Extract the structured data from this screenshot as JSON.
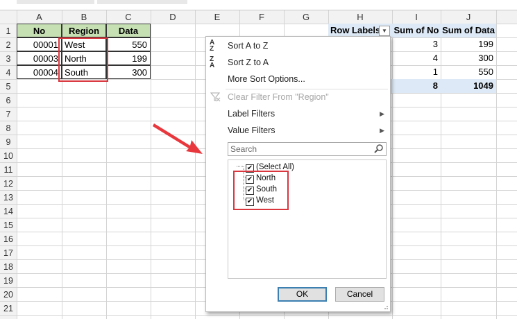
{
  "columns": [
    "A",
    "B",
    "C",
    "D",
    "E",
    "F",
    "G",
    "H",
    "I",
    "J"
  ],
  "rows": [
    "1",
    "2",
    "3",
    "4",
    "5",
    "6",
    "7",
    "8",
    "9",
    "10",
    "11",
    "12",
    "13",
    "14",
    "15",
    "16",
    "17",
    "18",
    "19",
    "20",
    "21"
  ],
  "source_table": {
    "headers": [
      "No",
      "Region",
      "Data"
    ],
    "rows": [
      {
        "no": "00001",
        "region": "West",
        "data": "550"
      },
      {
        "no": "00003",
        "region": "North",
        "data": "199"
      },
      {
        "no": "00004",
        "region": "South",
        "data": "300"
      }
    ],
    "header_color": "#c6e0b4"
  },
  "pivot": {
    "row_labels_header": "Row Labels",
    "sum_no_header": "Sum of No",
    "sum_data_header": "Sum of Data",
    "rows": [
      {
        "no": "3",
        "data": "199"
      },
      {
        "no": "4",
        "data": "300"
      },
      {
        "no": "1",
        "data": "550"
      }
    ],
    "total": {
      "no": "8",
      "data": "1049"
    },
    "header_color": "#dde9f6",
    "total_color": "#dde9f6"
  },
  "menu": {
    "sort_az": "Sort A to Z",
    "sort_za": "Sort Z to A",
    "more_sort": "More Sort Options...",
    "clear_filter": "Clear Filter From \"Region\"",
    "label_filters": "Label Filters",
    "value_filters": "Value Filters",
    "search_placeholder": "Search",
    "items": [
      {
        "label": "(Select All)",
        "checked": true
      },
      {
        "label": "North",
        "checked": true
      },
      {
        "label": "South",
        "checked": true
      },
      {
        "label": "West",
        "checked": true
      }
    ],
    "ok": "OK",
    "cancel": "Cancel"
  },
  "colors": {
    "highlight_red": "#d9363e",
    "arrow_red": "#e8383d",
    "grid_line": "#d4d4d4",
    "header_bg": "#f2f2f2"
  }
}
